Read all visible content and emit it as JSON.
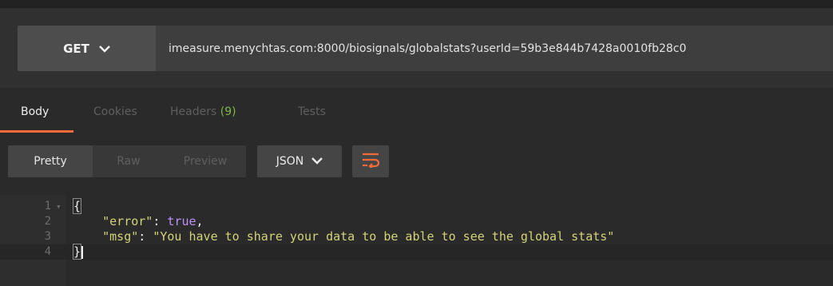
{
  "request": {
    "method": "GET",
    "url": "imeasure.menychtas.com:8000/biosignals/globalstats?userId=59b3e844b7428a0010fb28c0"
  },
  "tabs": {
    "body": "Body",
    "cookies": "Cookies",
    "headers": "Headers",
    "headers_count": "(9)",
    "tests": "Tests"
  },
  "response_toolbar": {
    "pretty": "Pretty",
    "raw": "Raw",
    "preview": "Preview",
    "format": "JSON"
  },
  "editor": {
    "lines": [
      {
        "number": "1",
        "text": "{"
      },
      {
        "number": "2",
        "key": "\"error\"",
        "colon": ": ",
        "value": "true",
        "trail": ","
      },
      {
        "number": "3",
        "key": "\"msg\"",
        "colon": ": ",
        "value": "\"You have to share your data to be able to see the global stats\"",
        "trail": ""
      },
      {
        "number": "4",
        "text": "}"
      }
    ]
  },
  "colors": {
    "accent": "#f26b3a",
    "count": "#7fb947",
    "string": "#d3d37a",
    "boolean": "#bd93f9"
  }
}
